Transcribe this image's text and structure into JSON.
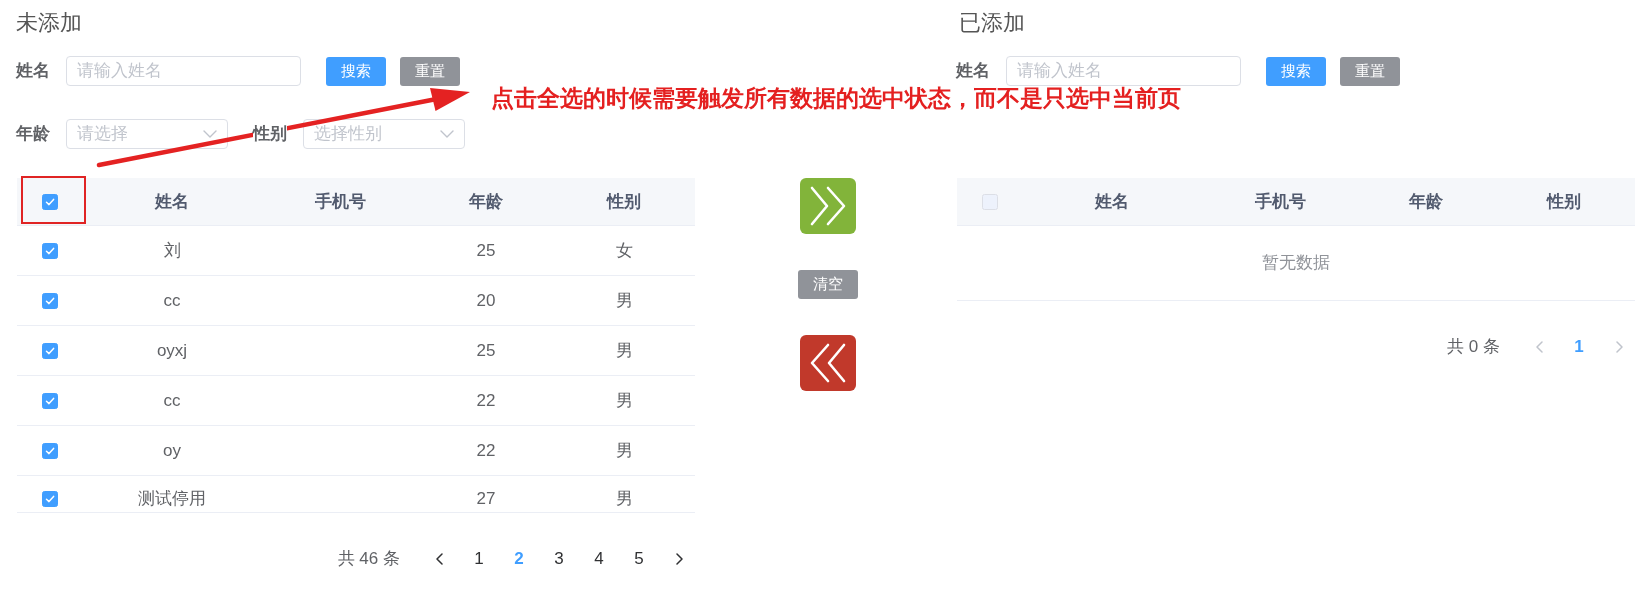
{
  "panels": [
    {
      "title": "未添加",
      "filter_rows": [
        {
          "fields": [
            {
              "kind": "input",
              "label": "姓名",
              "placeholder": "请输入姓名"
            }
          ],
          "buttons": [
            {
              "kind": "primary",
              "label": "搜索"
            },
            {
              "kind": "info",
              "label": "重置"
            }
          ]
        },
        {
          "fields": [
            {
              "kind": "select",
              "label": "年龄",
              "placeholder": "请选择"
            },
            {
              "kind": "select",
              "label": "性别",
              "placeholder": "选择性别"
            }
          ]
        }
      ],
      "table": {
        "select_all": {
          "checked": true,
          "disabled": false
        },
        "columns": [
          "姓名",
          "手机号",
          "年龄",
          "性别"
        ],
        "rows": [
          {
            "checked": true,
            "name": "刘",
            "age": "25",
            "gender": "女"
          },
          {
            "checked": true,
            "name": "cc",
            "age": "20",
            "gender": "男"
          },
          {
            "checked": true,
            "name": "oyxj",
            "age": "25",
            "gender": "男"
          },
          {
            "checked": true,
            "name": "cc",
            "age": "22",
            "gender": "男"
          },
          {
            "checked": true,
            "name": "oy",
            "age": "22",
            "gender": "男"
          },
          {
            "checked": true,
            "name": "测试停用",
            "age": "27",
            "gender": "男"
          }
        ]
      },
      "pagination": {
        "total": "共 46 条",
        "prev_disabled": false,
        "next_disabled": false,
        "pages": [
          {
            "label": "1",
            "selected": false
          },
          {
            "label": "2",
            "selected": true
          },
          {
            "label": "3",
            "selected": false
          },
          {
            "label": "4",
            "selected": false
          },
          {
            "label": "5",
            "selected": false
          }
        ]
      }
    },
    {
      "title": "已添加",
      "filter_rows": [
        {
          "fields": [
            {
              "kind": "input",
              "label": "姓名",
              "placeholder": "请输入姓名"
            }
          ],
          "buttons": [
            {
              "kind": "primary",
              "label": "搜索"
            },
            {
              "kind": "info",
              "label": "重置"
            }
          ]
        }
      ],
      "table": {
        "select_all": {
          "checked": false,
          "disabled": true
        },
        "columns": [
          "姓名",
          "手机号",
          "年龄",
          "性别"
        ],
        "empty_text": "暂无数据"
      },
      "pagination": {
        "total": "共 0 条",
        "prev_disabled": true,
        "next_disabled": true,
        "pages": [
          {
            "label": "1",
            "selected": true
          }
        ]
      }
    }
  ],
  "transfer_buttons": [
    {
      "kind": "move_right"
    },
    {
      "kind": "clear",
      "label": "清空"
    },
    {
      "kind": "move_left"
    }
  ],
  "annotation": {
    "text": "点击全选的时候需要触发所有数据的选中状态，而不是只选中当前页"
  }
}
